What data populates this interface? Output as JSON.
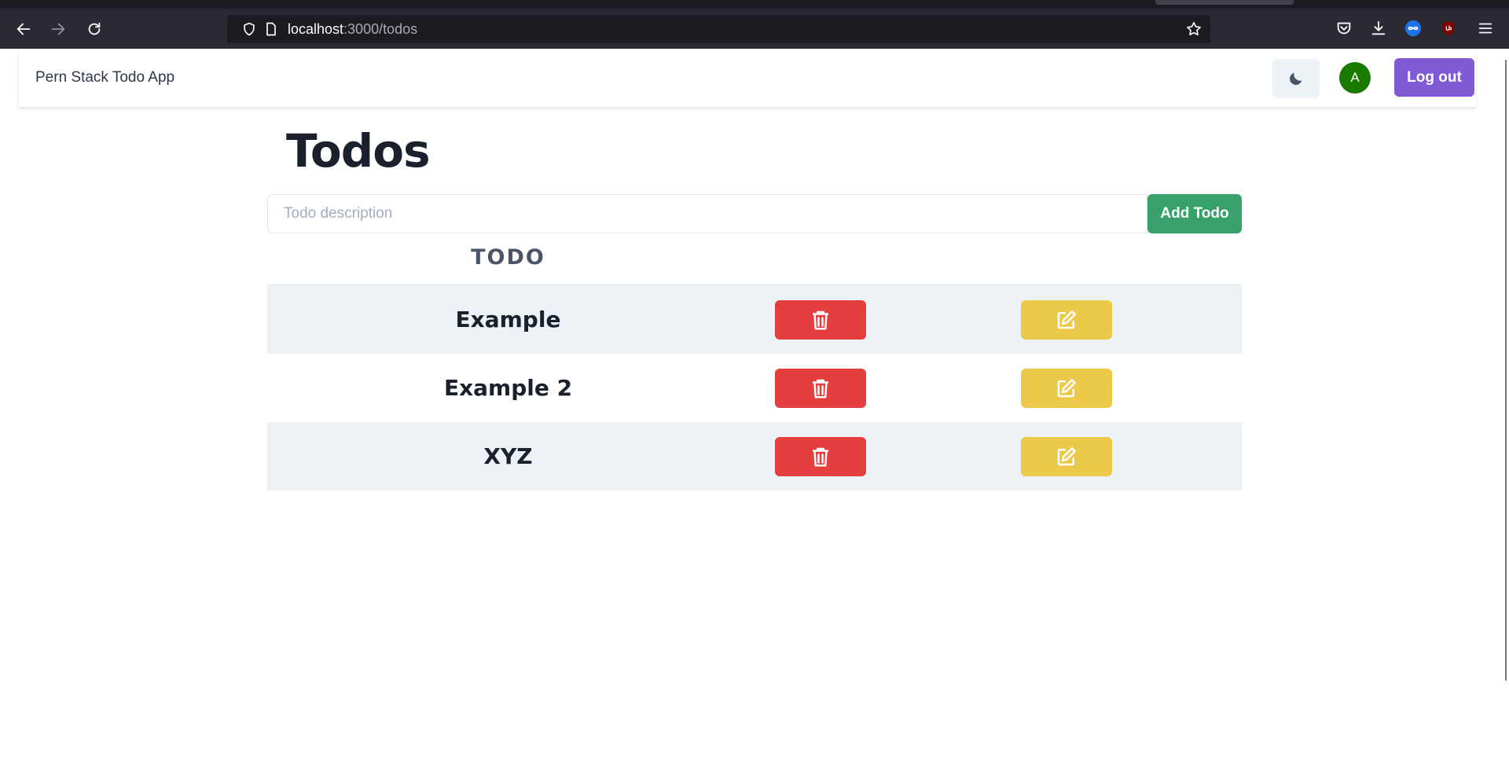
{
  "browser": {
    "url_host": "localhost",
    "url_path": ":3000/todos"
  },
  "app": {
    "brand": "Pern Stack Todo App",
    "avatar_initial": "A",
    "logout_label": "Log out"
  },
  "main": {
    "title": "Todos",
    "input_placeholder": "Todo description",
    "input_value": "",
    "add_button_label": "Add Todo",
    "column_header": "TODO",
    "todos": [
      {
        "description": "Example"
      },
      {
        "description": "Example 2"
      },
      {
        "description": "XYZ"
      }
    ]
  },
  "colors": {
    "delete": "#e53e3e",
    "edit": "#ecc94b",
    "add": "#38a169",
    "logout": "#805ad5",
    "avatar": "#1a7a00"
  },
  "icons": {
    "theme_toggle": "moon-icon",
    "delete": "trash-icon",
    "edit": "edit-icon"
  }
}
